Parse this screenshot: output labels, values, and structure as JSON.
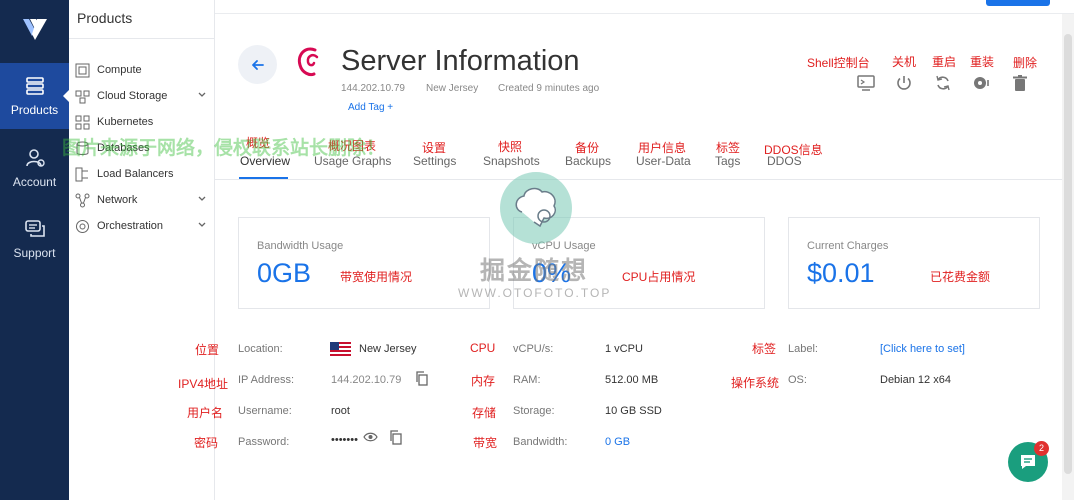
{
  "rail": {
    "items": [
      {
        "label": "Products",
        "icon": "products-icon"
      },
      {
        "label": "Account",
        "icon": "account-icon"
      },
      {
        "label": "Support",
        "icon": "support-icon"
      }
    ]
  },
  "subnav": {
    "title": "Products",
    "items": [
      {
        "label": "Compute",
        "icon": "compute-icon",
        "expandable": false
      },
      {
        "label": "Cloud Storage",
        "icon": "cloud-storage-icon",
        "expandable": true
      },
      {
        "label": "Kubernetes",
        "icon": "kubernetes-icon",
        "expandable": false
      },
      {
        "label": "Databases",
        "icon": "databases-icon",
        "expandable": false
      },
      {
        "label": "Load Balancers",
        "icon": "load-balancers-icon",
        "expandable": false
      },
      {
        "label": "Network",
        "icon": "network-icon",
        "expandable": true
      },
      {
        "label": "Orchestration",
        "icon": "orchestration-icon",
        "expandable": true
      }
    ]
  },
  "header": {
    "title": "Server Information",
    "ip": "144.202.10.79",
    "location": "New Jersey",
    "created": "Created 9 minutes ago",
    "add_tag": "Add Tag +"
  },
  "actions": {
    "shell_note": "Shell控制台",
    "power_note": "关机",
    "restart_note": "重启",
    "reinstall_note": "重装",
    "delete_note": "删除"
  },
  "tabs": [
    {
      "label": "Overview",
      "note": "概览"
    },
    {
      "label": "Usage Graphs",
      "note": "概况图表"
    },
    {
      "label": "Settings",
      "note": "设置"
    },
    {
      "label": "Snapshots",
      "note": "快照"
    },
    {
      "label": "Backups",
      "note": "备份"
    },
    {
      "label": "User-Data",
      "note": "用户信息"
    },
    {
      "label": "Tags",
      "note": "标签"
    },
    {
      "label": "DDOS",
      "note": "DDOS信息"
    }
  ],
  "cards": {
    "bandwidth": {
      "label": "Bandwidth Usage",
      "value": "0GB",
      "note": "带宽使用情况"
    },
    "vcpu": {
      "label": "vCPU Usage",
      "value": "0%",
      "note": "CPU占用情况"
    },
    "charges": {
      "label": "Current Charges",
      "value": "$0.01",
      "note": "已花费金额"
    }
  },
  "details": {
    "location": {
      "note": "位置",
      "label": "Location:",
      "value": "New Jersey"
    },
    "ip": {
      "note": "IPV4地址",
      "label": "IP Address:",
      "value": "144.202.10.79"
    },
    "username": {
      "note": "用户名",
      "label": "Username:",
      "value": "root"
    },
    "password": {
      "note": "密码",
      "label": "Password:",
      "value": "•••••••"
    },
    "vcpus": {
      "note": "CPU",
      "label": "vCPU/s:",
      "value": "1 vCPU"
    },
    "ram": {
      "note": "内存",
      "label": "RAM:",
      "value": "512.00 MB"
    },
    "storage": {
      "note": "存储",
      "label": "Storage:",
      "value": "10 GB SSD"
    },
    "bandwidth": {
      "note": "带宽",
      "label": "Bandwidth:",
      "value": "0 GB"
    },
    "label": {
      "note": "标签",
      "label": "Label:",
      "value": "[Click here to set]"
    },
    "os": {
      "note": "操作系统",
      "label": "OS:",
      "value": "Debian 12 x64"
    }
  },
  "watermark": {
    "banner": "图片来源于网络，侵权联系站长删除！",
    "brand": "掘金随想",
    "domain": "WWW.OTOFOTO.TOP"
  },
  "chat": {
    "badge": "2"
  },
  "colors": {
    "rail": "#142a4f",
    "rail_active": "#1e4a9e",
    "accent": "#1a73e8",
    "annotation": "#e02020",
    "chat": "#1a9e7e"
  }
}
